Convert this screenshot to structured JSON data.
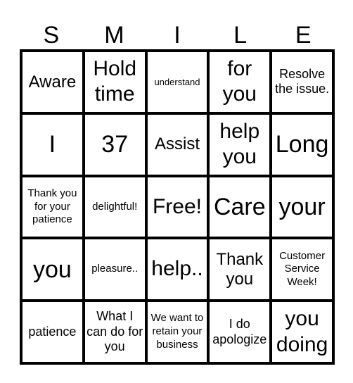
{
  "title_letters": [
    "S",
    "M",
    "I",
    "L",
    "E"
  ],
  "board": [
    [
      {
        "text": "Aware",
        "size": "ml"
      },
      {
        "text": "Hold time",
        "size": "lg"
      },
      {
        "text": "understand",
        "size": "xs"
      },
      {
        "text": "for you",
        "size": "lg"
      },
      {
        "text": "Resolve the issue.",
        "size": "md"
      }
    ],
    [
      {
        "text": "I",
        "size": "xl"
      },
      {
        "text": "37",
        "size": "xl"
      },
      {
        "text": "Assist",
        "size": "ml"
      },
      {
        "text": "help you",
        "size": "lg"
      },
      {
        "text": "Long",
        "size": "xl"
      }
    ],
    [
      {
        "text": "Thank you for your patience",
        "size": "sm"
      },
      {
        "text": "delightful!",
        "size": "sm"
      },
      {
        "text": "Free!",
        "size": "lg"
      },
      {
        "text": "Care",
        "size": "xl"
      },
      {
        "text": "your",
        "size": "xl"
      }
    ],
    [
      {
        "text": "you",
        "size": "xl"
      },
      {
        "text": "pleasure..",
        "size": "sm"
      },
      {
        "text": "help..",
        "size": "lg"
      },
      {
        "text": "Thank you",
        "size": "ml"
      },
      {
        "text": "Customer Service Week!",
        "size": "sm"
      }
    ],
    [
      {
        "text": "patience",
        "size": "md"
      },
      {
        "text": "What I can do for you",
        "size": "md"
      },
      {
        "text": "We want to retain your business",
        "size": "sm"
      },
      {
        "text": "I do apologize",
        "size": "md"
      },
      {
        "text": "you doing",
        "size": "lg"
      }
    ]
  ]
}
